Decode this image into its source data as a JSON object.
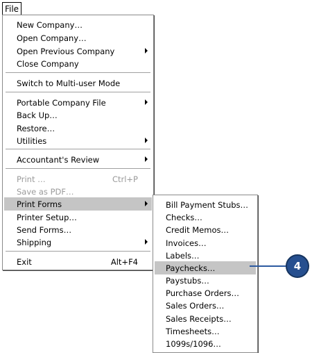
{
  "menubar": {
    "file": "File"
  },
  "file_menu": {
    "new_company": "New Company…",
    "open_company": "Open Company…",
    "open_previous": "Open Previous Company",
    "close_company": "Close Company",
    "switch_multiuser": "Switch to Multi-user Mode",
    "portable": "Portable Company File",
    "back_up": "Back Up…",
    "restore": "Restore…",
    "utilities": "Utilities",
    "accountants_review": "Accountant's Review",
    "print": "Print …",
    "print_shortcut": "Ctrl+P",
    "save_pdf": "Save as PDF…",
    "print_forms": "Print Forms",
    "printer_setup": "Printer Setup…",
    "send_forms": "Send Forms…",
    "shipping": "Shipping",
    "exit": "Exit",
    "exit_shortcut": "Alt+F4"
  },
  "print_forms_menu": {
    "bill_payment_stubs": "Bill Payment Stubs…",
    "checks": "Checks…",
    "credit_memos": "Credit Memos…",
    "invoices": "Invoices…",
    "labels": "Labels…",
    "paychecks": "Paychecks…",
    "paystubs": "Paystubs…",
    "purchase_orders": "Purchase Orders…",
    "sales_orders": "Sales Orders…",
    "sales_receipts": "Sales Receipts…",
    "timesheets": "Timesheets…",
    "forms_1099": "1099s/1096…"
  },
  "callout": {
    "step": "4"
  }
}
